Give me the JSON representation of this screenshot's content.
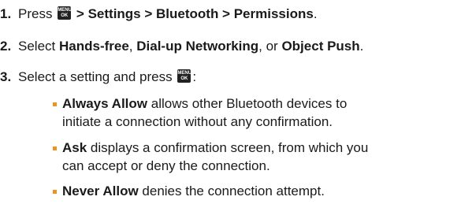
{
  "steps": [
    {
      "number": "1.",
      "prefix": "Press",
      "path": " > Settings > Bluetooth > Permissions",
      "end": "."
    },
    {
      "number": "2.",
      "prefix": "Select ",
      "opt1": "Hands-free",
      "sep1": ", ",
      "opt2": "Dial-up Networking",
      "sep2": ", or ",
      "opt3": "Object Push",
      "end": "."
    },
    {
      "number": "3.",
      "text": "Select a setting and press",
      "end": ":"
    }
  ],
  "menu_key": {
    "top": "MENU",
    "bottom": "OK",
    "icon": "menu-ok-key-icon"
  },
  "options": [
    {
      "term": "Always Allow",
      "line1": " allows other Bluetooth devices to",
      "line2": "initiate a connection without any confirmation."
    },
    {
      "term": "Ask",
      "line1": " displays a confirmation screen, from which you",
      "line2": "can accept or deny the connection."
    },
    {
      "term": "Never Allow",
      "line1": " denies the connection attempt."
    }
  ],
  "colors": {
    "bullet": "#f0921e",
    "text": "#1a1a1a",
    "key": "#222222"
  }
}
